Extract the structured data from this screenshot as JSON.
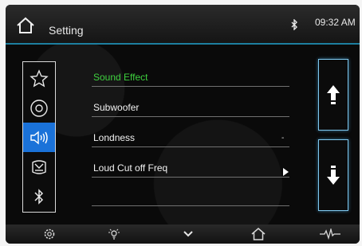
{
  "header": {
    "title": "Setting",
    "time": "09:32 AM"
  },
  "icons": {
    "home": "home-icon",
    "bluetooth_status": "bluetooth-icon"
  },
  "sidebar": {
    "tabs": [
      {
        "icon": "star-icon",
        "active": false
      },
      {
        "icon": "disc-icon",
        "active": false
      },
      {
        "icon": "speaker-icon",
        "active": true
      },
      {
        "icon": "car-icon",
        "active": false
      },
      {
        "icon": "bluetooth-icon",
        "active": false
      }
    ]
  },
  "menu": {
    "items": [
      {
        "label": "Sound Effect",
        "selected": true
      },
      {
        "label": "Subwoofer",
        "selected": false
      },
      {
        "label": "Londness",
        "selected": false,
        "value": "-"
      },
      {
        "label": "Loud Cut off Freq",
        "selected": false,
        "has_submenu": true
      }
    ]
  },
  "scroll": {
    "up": "arrow-up-icon",
    "down": "arrow-down-icon"
  },
  "bottom_bar": {
    "icons": [
      "settings-icon",
      "brightness-icon",
      "chevron-down-icon",
      "home-icon",
      "waveform-icon"
    ]
  },
  "colors": {
    "selected_text": "#3fd13f",
    "active_tab": "#1a72d9",
    "accent_line": "#1d7fa0",
    "scroll_border": "#7fc9f0"
  }
}
